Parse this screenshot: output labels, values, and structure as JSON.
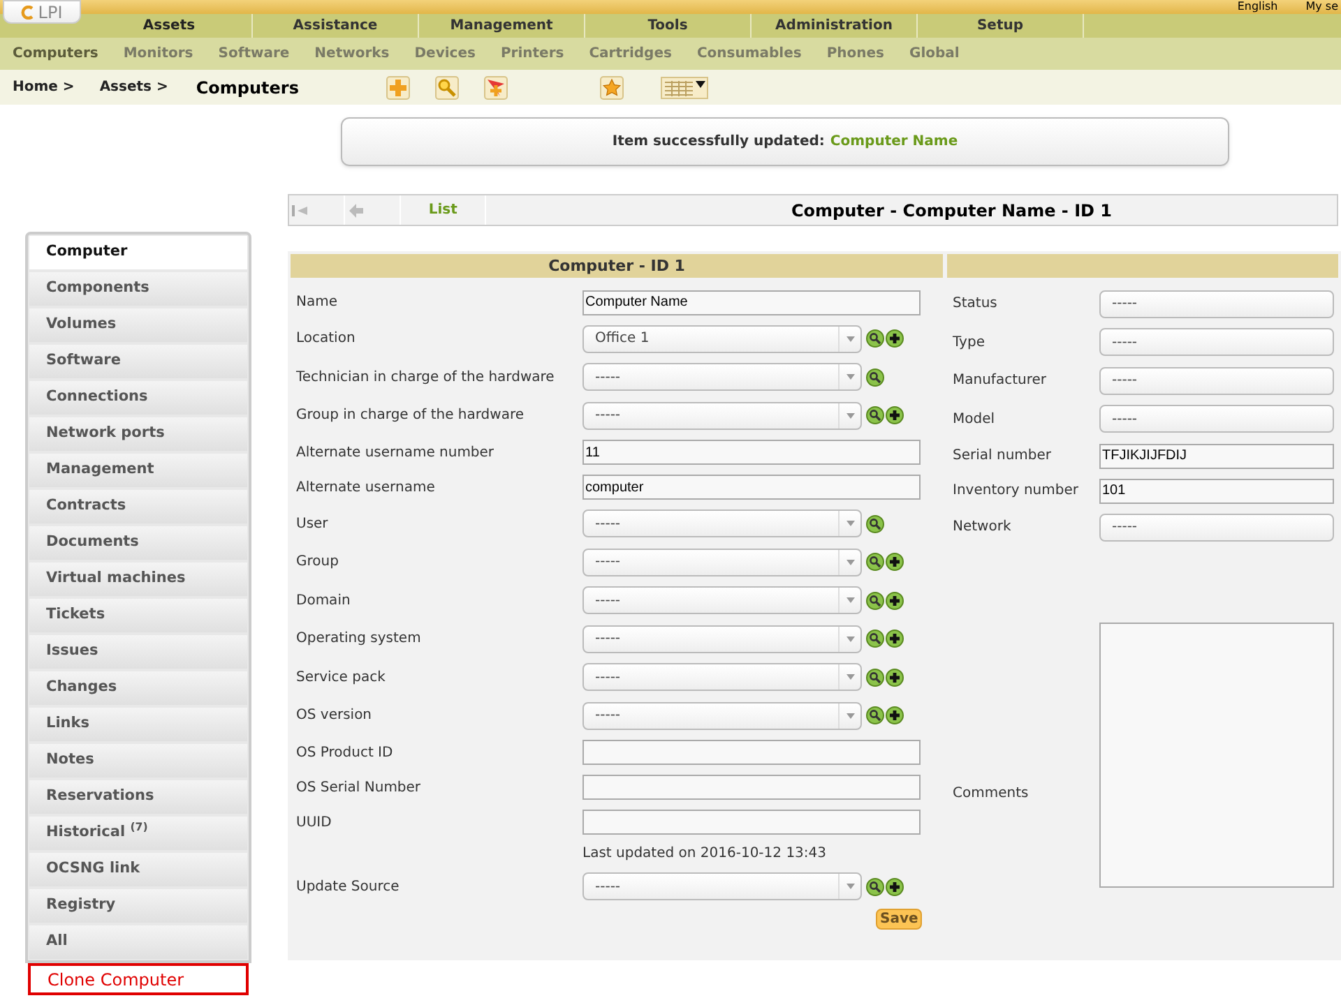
{
  "header": {
    "logo": "LPI",
    "top_links": [
      "English",
      "My se"
    ]
  },
  "menu": [
    {
      "label": "Assets",
      "selected": true
    },
    {
      "label": "Assistance",
      "selected": false
    },
    {
      "label": "Management",
      "selected": false
    },
    {
      "label": "Tools",
      "selected": false
    },
    {
      "label": "Administration",
      "selected": false
    },
    {
      "label": "Setup",
      "selected": false
    }
  ],
  "submenu": [
    {
      "label": "Computers",
      "selected": true
    },
    {
      "label": "Monitors",
      "selected": false
    },
    {
      "label": "Software",
      "selected": false
    },
    {
      "label": "Networks",
      "selected": false
    },
    {
      "label": "Devices",
      "selected": false
    },
    {
      "label": "Printers",
      "selected": false
    },
    {
      "label": "Cartridges",
      "selected": false
    },
    {
      "label": "Consumables",
      "selected": false
    },
    {
      "label": "Phones",
      "selected": false
    },
    {
      "label": "Global",
      "selected": false
    }
  ],
  "breadcrumb": {
    "items": [
      "Home >",
      "Assets >"
    ],
    "current": "Computers"
  },
  "message": {
    "text": "Item successfully updated:",
    "link": "Computer Name"
  },
  "nav": {
    "list": "List",
    "title": "Computer - Computer Name - ID 1"
  },
  "tabs": [
    {
      "label": "Computer",
      "selected": true
    },
    {
      "label": "Components",
      "selected": false
    },
    {
      "label": "Volumes",
      "selected": false
    },
    {
      "label": "Software",
      "selected": false
    },
    {
      "label": "Connections",
      "selected": false
    },
    {
      "label": "Network ports",
      "selected": false
    },
    {
      "label": "Management",
      "selected": false
    },
    {
      "label": "Contracts",
      "selected": false
    },
    {
      "label": "Documents",
      "selected": false
    },
    {
      "label": "Virtual machines",
      "selected": false
    },
    {
      "label": "Tickets",
      "selected": false
    },
    {
      "label": "Issues",
      "selected": false
    },
    {
      "label": "Changes",
      "selected": false
    },
    {
      "label": "Links",
      "selected": false
    },
    {
      "label": "Notes",
      "selected": false
    },
    {
      "label": "Reservations",
      "selected": false
    },
    {
      "label": "Historical $^{(7)}$",
      "selected": false
    },
    {
      "label": "OCSNG link",
      "selected": false
    },
    {
      "label": "Registry",
      "selected": false
    },
    {
      "label": "All",
      "selected": false
    }
  ],
  "clone_button": "Clone Computer",
  "form": {
    "title": "Computer - ID 1",
    "left": [
      {
        "kind": "text",
        "label": "Name",
        "value": "Computer Name"
      },
      {
        "kind": "select",
        "label": "Location",
        "value": "Office 1",
        "search": true,
        "add": true
      },
      {
        "kind": "select",
        "label": "Technician in charge of the hardware",
        "value": "-----",
        "search": true,
        "add": false
      },
      {
        "kind": "select",
        "label": "Group in charge of the hardware",
        "value": "-----",
        "search": true,
        "add": true
      },
      {
        "kind": "text",
        "label": "Alternate username number",
        "value": "11"
      },
      {
        "kind": "text",
        "label": "Alternate username",
        "value": "computer"
      },
      {
        "kind": "select",
        "label": "User",
        "value": "-----",
        "search": true,
        "add": false
      },
      {
        "kind": "select",
        "label": "Group",
        "value": "-----",
        "search": true,
        "add": true
      },
      {
        "kind": "select",
        "label": "Domain",
        "value": "-----",
        "search": true,
        "add": true
      },
      {
        "kind": "select",
        "label": "Operating system",
        "value": "-----",
        "search": true,
        "add": true
      },
      {
        "kind": "select",
        "label": "Service pack",
        "value": "-----",
        "search": true,
        "add": true
      },
      {
        "kind": "select",
        "label": "OS version",
        "value": "-----",
        "search": true,
        "add": true
      },
      {
        "kind": "text",
        "label": "OS Product ID"
      },
      {
        "kind": "text",
        "label": "OS Serial Number"
      },
      {
        "kind": "text",
        "label": "UUID"
      },
      {
        "kind": "note",
        "value": "Last updated on 2016-10-12 13:43"
      },
      {
        "kind": "select",
        "label": "Update Source",
        "value": "-----",
        "search": true,
        "add": true
      }
    ],
    "right": [
      {
        "kind": "select",
        "label": "Status",
        "value": "-----"
      },
      {
        "kind": "select",
        "label": "Type",
        "value": "-----"
      },
      {
        "kind": "select",
        "label": "Manufacturer",
        "value": "-----"
      },
      {
        "kind": "select",
        "label": "Model",
        "value": "-----"
      },
      {
        "kind": "text",
        "label": "Serial number",
        "value": "TFJIKJIJFDIJ"
      },
      {
        "kind": "text",
        "label": "Inventory number",
        "value": "101"
      },
      {
        "kind": "select",
        "label": "Network",
        "value": "-----"
      },
      {
        "kind": "textarea",
        "label": "Comments"
      }
    ],
    "save": "Save"
  }
}
